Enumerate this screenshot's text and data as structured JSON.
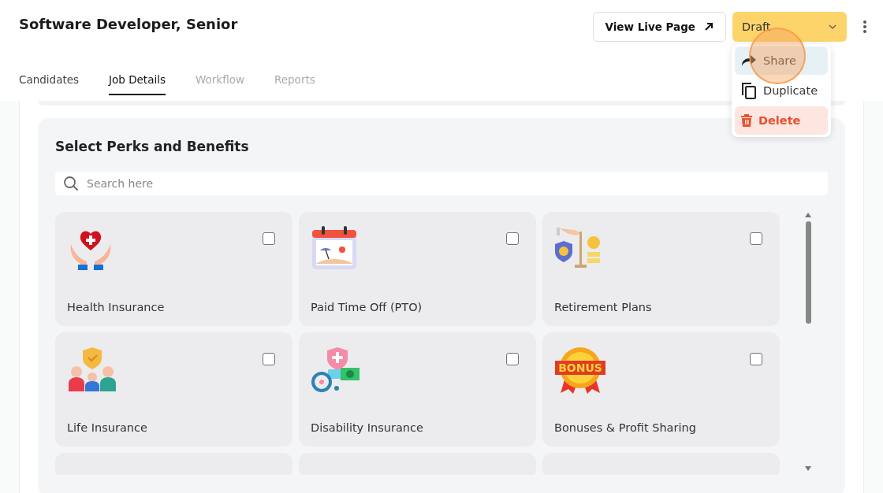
{
  "job_title": "Software Developer, Senior",
  "view_live_button": {
    "label": "View Live Page"
  },
  "status_dropdown": {
    "value": "Draft"
  },
  "menu": [
    {
      "label": "Share",
      "kind": "share",
      "highlighted": true
    },
    {
      "label": "Duplicate",
      "kind": "duplicate",
      "highlighted": false
    },
    {
      "label": "Delete",
      "kind": "delete",
      "highlighted": false
    }
  ],
  "tabs": [
    {
      "label": "Candidates",
      "selected": false,
      "disabled": false
    },
    {
      "label": "Job Details",
      "selected": true,
      "disabled": false
    },
    {
      "label": "Workflow",
      "selected": false,
      "disabled": true
    },
    {
      "label": "Reports",
      "selected": false,
      "disabled": true
    }
  ],
  "perks": {
    "title": "Select Perks and Benefits",
    "search": {
      "placeholder": "Search here"
    },
    "items": [
      {
        "label": "Health Insurance",
        "kind": "health",
        "checked": false
      },
      {
        "label": "Paid Time Off (PTO)",
        "kind": "pto",
        "checked": false
      },
      {
        "label": "Retirement Plans",
        "kind": "retirement",
        "checked": false
      },
      {
        "label": "Life Insurance",
        "kind": "life",
        "checked": false
      },
      {
        "label": "Disability Insurance",
        "kind": "disability",
        "checked": false
      },
      {
        "label": "Bonuses & Profit Sharing",
        "kind": "bonus",
        "checked": false,
        "badge_text": "BONUS"
      }
    ]
  }
}
